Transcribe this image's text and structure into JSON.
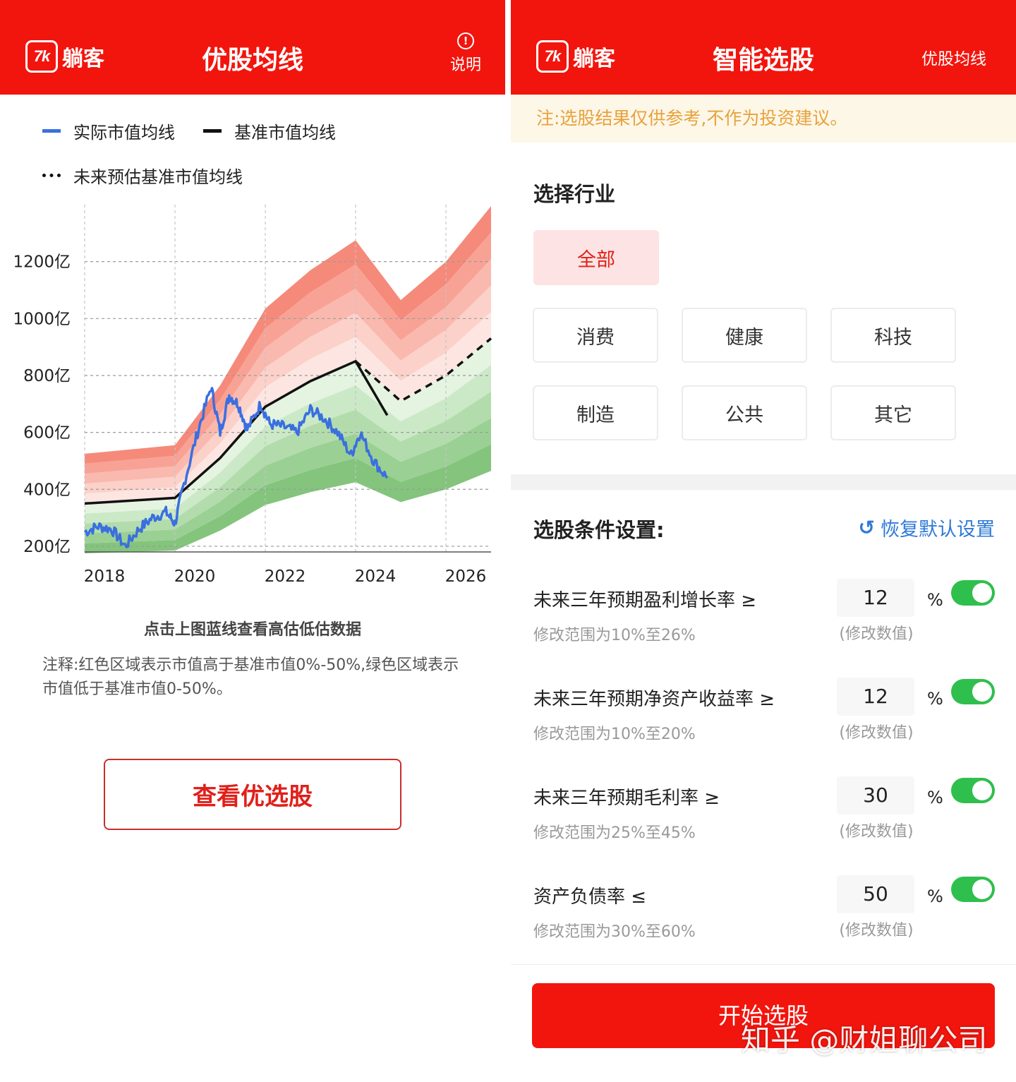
{
  "left": {
    "header": {
      "logo_mark": "7k",
      "logo_text": "躺客",
      "title": "优股均线",
      "help_icon": "!",
      "help_label": "说明"
    },
    "legend": [
      {
        "label": "实际市值均线",
        "color": "#3a6fe0",
        "style": "solid"
      },
      {
        "label": "基准市值均线",
        "color": "#111111",
        "style": "solid"
      },
      {
        "label": "未来预估基准市值均线",
        "color": "#111111",
        "style": "dotted"
      }
    ],
    "chart_hint": "点击上图蓝线查看高估低估数据",
    "chart_note": "注释:红色区域表示市值高于基准市值0%-50%,绿色区域表示市值低于基准市值0-50%。",
    "view_button": "查看优选股"
  },
  "chart_data": {
    "type": "line",
    "x_ticks": [
      "2018",
      "2020",
      "2022",
      "2024",
      "2026"
    ],
    "y_ticks": [
      "200亿",
      "400亿",
      "600亿",
      "800亿",
      "1000亿",
      "1200亿"
    ],
    "xlim": [
      2018,
      2027
    ],
    "ylim": [
      180,
      1400
    ],
    "grid": true,
    "colors": {
      "actual": "#3a6fe0",
      "baseline": "#111111",
      "above_band": "#f08070",
      "below_band": "#7fc67a"
    },
    "series": [
      {
        "name": "基准市值均线",
        "x": [
          2018,
          2020,
          2021,
          2022,
          2023,
          2024,
          2024.7
        ],
        "values": [
          350,
          370,
          510,
          690,
          780,
          850,
          660
        ]
      },
      {
        "name": "未来预估基准市值均线",
        "x": [
          2024,
          2025,
          2026,
          2027
        ],
        "values": [
          850,
          710,
          800,
          930
        ]
      },
      {
        "name": "实际市值均线",
        "x": [
          2018,
          2018.3,
          2018.6,
          2018.9,
          2019.2,
          2019.5,
          2019.8,
          2020.0,
          2020.2,
          2020.5,
          2020.8,
          2021.0,
          2021.2,
          2021.4,
          2021.6,
          2021.9,
          2022.1,
          2022.4,
          2022.7,
          2023.0,
          2023.3,
          2023.6,
          2023.9,
          2024.1,
          2024.4,
          2024.7
        ],
        "values": [
          250,
          270,
          260,
          200,
          260,
          300,
          320,
          280,
          420,
          600,
          760,
          600,
          730,
          700,
          610,
          700,
          630,
          620,
          600,
          680,
          650,
          600,
          520,
          600,
          500,
          440
        ]
      }
    ]
  },
  "right": {
    "header": {
      "logo_mark": "7k",
      "logo_text": "躺客",
      "title": "智能选股",
      "link": "优股均线"
    },
    "notice": "注:选股结果仅供参考,不作为投资建议。",
    "industry_title": "选择行业",
    "industries": [
      {
        "label": "全部",
        "active": true
      },
      {
        "label": "消费",
        "active": false
      },
      {
        "label": "健康",
        "active": false
      },
      {
        "label": "科技",
        "active": false
      },
      {
        "label": "制造",
        "active": false
      },
      {
        "label": "公共",
        "active": false
      },
      {
        "label": "其它",
        "active": false
      }
    ],
    "conditions_title": "选股条件设置:",
    "reset_label": "恢复默认设置",
    "conditions": [
      {
        "label": "未来三年预期盈利增长率 ≥",
        "range": "修改范围为10%至26%",
        "value": "12",
        "hint": "(修改数值)",
        "unit": "%",
        "enabled": true
      },
      {
        "label": "未来三年预期净资产收益率 ≥",
        "range": "修改范围为10%至20%",
        "value": "12",
        "hint": "(修改数值)",
        "unit": "%",
        "enabled": true
      },
      {
        "label": "未来三年预期毛利率 ≥",
        "range": "修改范围为25%至45%",
        "value": "30",
        "hint": "(修改数值)",
        "unit": "%",
        "enabled": true
      },
      {
        "label": "资产负债率 ≤",
        "range": "修改范围为30%至60%",
        "value": "50",
        "hint": "(修改数值)",
        "unit": "%",
        "enabled": true
      }
    ],
    "start_button": "开始选股",
    "watermark": "知乎 @财姐聊公司"
  }
}
